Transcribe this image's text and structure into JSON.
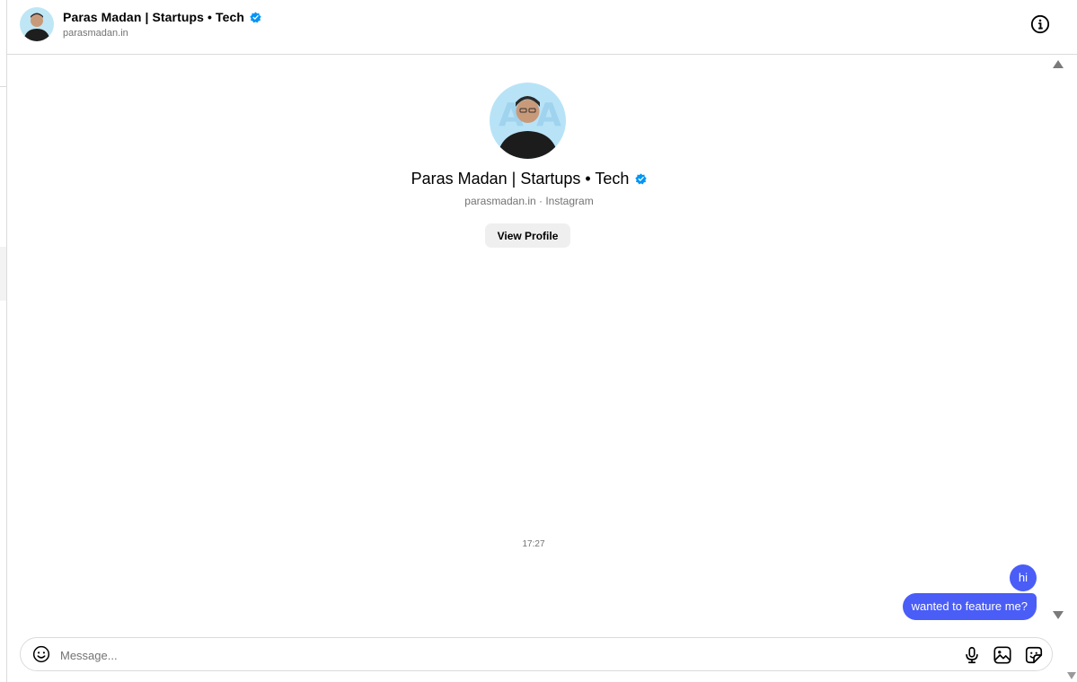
{
  "header": {
    "name": "Paras Madan | Startups • Tech",
    "subtitle": "parasmadan.in"
  },
  "profile_card": {
    "name": "Paras Madan | Startups • Tech",
    "subtitle": "parasmadan.in · Instagram",
    "view_profile_label": "View Profile"
  },
  "conversation": {
    "timestamp": "17:27",
    "messages": [
      {
        "text": "hi",
        "from": "me"
      },
      {
        "text": "wanted to feature me?",
        "from": "me"
      }
    ]
  },
  "composer": {
    "placeholder": "Message..."
  },
  "colors": {
    "bubble": "#4a5df7",
    "verified": "#0095f6",
    "muted_text": "#737373"
  },
  "icons": [
    "info-icon",
    "verified-badge-icon",
    "emoji-icon",
    "microphone-icon",
    "gallery-icon",
    "sticker-icon"
  ]
}
